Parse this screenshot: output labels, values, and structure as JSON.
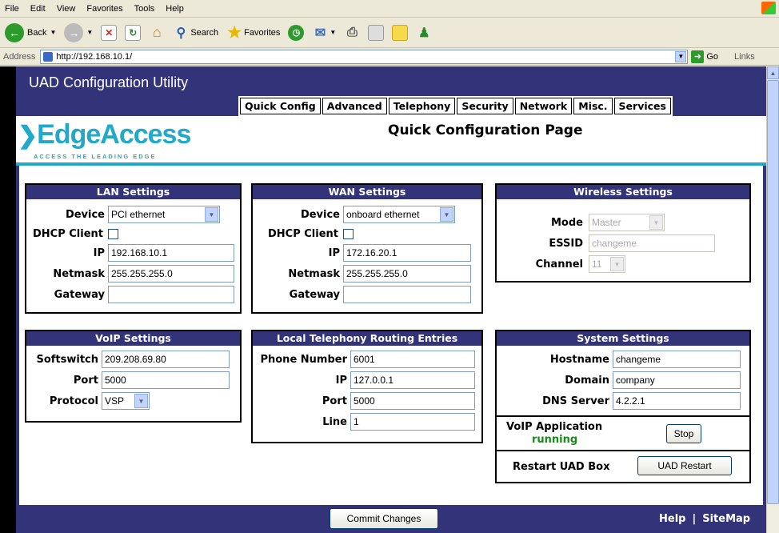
{
  "browser": {
    "menu": [
      "File",
      "Edit",
      "View",
      "Favorites",
      "Tools",
      "Help"
    ],
    "toolbar": {
      "back": "Back",
      "search": "Search",
      "favorites": "Favorites"
    },
    "address_label": "Address",
    "url": "http://192.168.10.1/",
    "go": "Go",
    "links": "Links"
  },
  "app": {
    "title": "UAD Configuration Utility",
    "tabs": [
      "Quick Config",
      "Advanced",
      "Telephony",
      "Security",
      "Network",
      "Misc.",
      "Services"
    ],
    "logo_name": "EdgeAccess",
    "logo_tagline": "ACCESS THE LEADING EDGE",
    "page_title": "Quick Configuration Page",
    "colors": {
      "header": "#33337a",
      "accent": "#22a8c8",
      "status_running": "#1a8a1a"
    }
  },
  "lan": {
    "title": "LAN Settings",
    "device_label": "Device",
    "device_value": "PCI ethernet",
    "dhcp_label": "DHCP Client",
    "ip_label": "IP",
    "ip_value": "192.168.10.1",
    "netmask_label": "Netmask",
    "netmask_value": "255.255.255.0",
    "gateway_label": "Gateway",
    "gateway_value": ""
  },
  "wan": {
    "title": "WAN Settings",
    "device_label": "Device",
    "device_value": "onboard ethernet",
    "dhcp_label": "DHCP Client",
    "ip_label": "IP",
    "ip_value": "172.16.20.1",
    "netmask_label": "Netmask",
    "netmask_value": "255.255.255.0",
    "gateway_label": "Gateway",
    "gateway_value": ""
  },
  "wireless": {
    "title": "Wireless Settings",
    "mode_label": "Mode",
    "mode_value": "Master",
    "essid_label": "ESSID",
    "essid_value": "changeme",
    "channel_label": "Channel",
    "channel_value": "11"
  },
  "voip": {
    "title": "VoIP Settings",
    "softswitch_label": "Softswitch",
    "softswitch_value": "209.208.69.80",
    "port_label": "Port",
    "port_value": "5000",
    "protocol_label": "Protocol",
    "protocol_value": "VSP"
  },
  "routing": {
    "title": "Local Telephony Routing Entries",
    "phone_label": "Phone Number",
    "phone_value": "6001",
    "ip_label": "IP",
    "ip_value": "127.0.0.1",
    "port_label": "Port",
    "port_value": "5000",
    "line_label": "Line",
    "line_value": "1"
  },
  "system": {
    "title": "System Settings",
    "hostname_label": "Hostname",
    "hostname_value": "changeme",
    "domain_label": "Domain",
    "domain_value": "company",
    "dns_label": "DNS Server",
    "dns_value": "4.2.2.1",
    "voip_app_label": "VoIP Application",
    "voip_app_status": "running",
    "stop_button": "Stop",
    "restart_label": "Restart UAD Box",
    "restart_button": "UAD Restart"
  },
  "footer": {
    "commit_button": "Commit Changes",
    "help": "Help",
    "separator": "|",
    "sitemap": "SiteMap"
  }
}
